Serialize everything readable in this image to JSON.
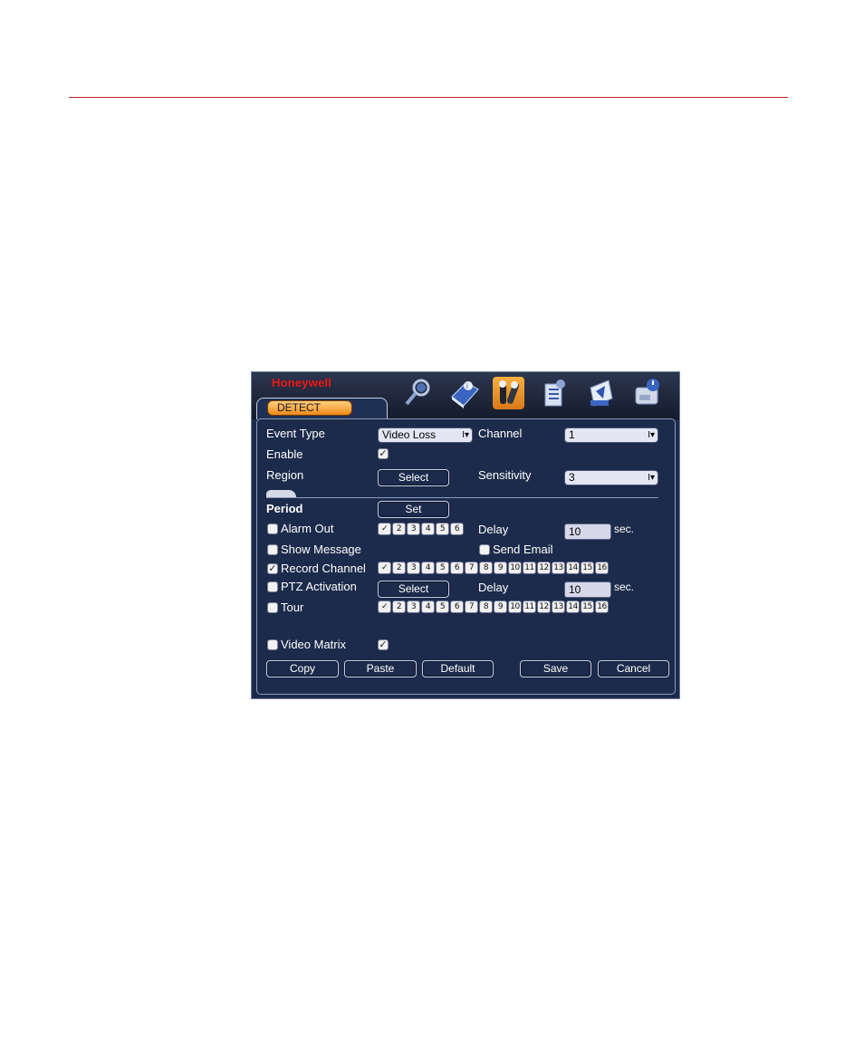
{
  "brand": "Honeywell",
  "tab_label": "DETECT",
  "toolbar_icons": [
    "search-icon",
    "info-book-icon",
    "setting-tools-icon",
    "advanced-list-icon",
    "backup-icon",
    "shutdown-icon"
  ],
  "fields": {
    "event_type_label": "Event Type",
    "event_type_value": "Video Loss",
    "channel_label": "Channel",
    "channel_value": "1",
    "enable_label": "Enable",
    "region_label": "Region",
    "region_button": "Select",
    "sensitivity_label": "Sensitivity",
    "sensitivity_value": "3",
    "period_label": "Period",
    "period_button": "Set",
    "alarm_out_label": "Alarm Out",
    "delay_label": "Delay",
    "alarm_delay_value": "10",
    "sec_label": "sec.",
    "show_message_label": "Show Message",
    "send_email_label": "Send Email",
    "record_channel_label": "Record Channel",
    "ptz_label": "PTZ Activation",
    "ptz_button": "Select",
    "ptz_delay_value": "10",
    "tour_label": "Tour",
    "video_matrix_label": "Video Matrix"
  },
  "dropdown_arrow": "I▾",
  "check_mark": "✓",
  "alarm_outputs": [
    "1",
    "2",
    "3",
    "4",
    "5",
    "6"
  ],
  "channels": [
    "1",
    "2",
    "3",
    "4",
    "5",
    "6",
    "7",
    "8",
    "9",
    "10",
    "11",
    "12",
    "13",
    "14",
    "15",
    "16"
  ],
  "buttons": {
    "copy": "Copy",
    "paste": "Paste",
    "default": "Default",
    "save": "Save",
    "cancel": "Cancel"
  },
  "colors": {
    "panel": "#1c2b4b",
    "accent_orange": "#f08a1a",
    "brand_red": "#e02020"
  }
}
